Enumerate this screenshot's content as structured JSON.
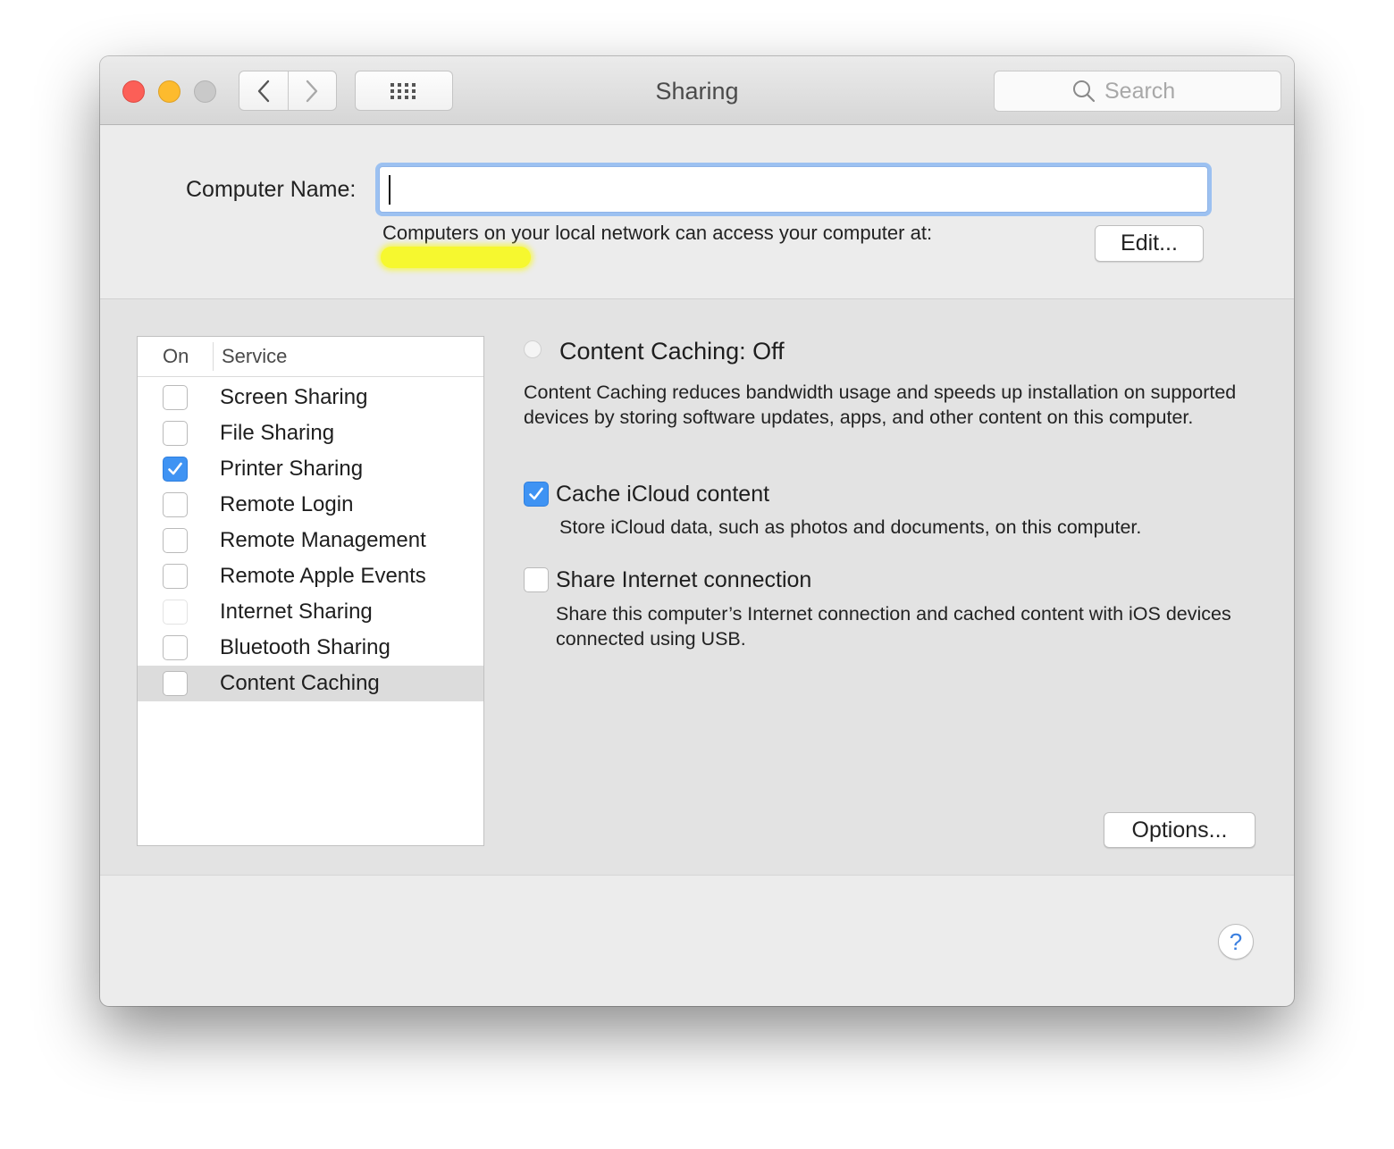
{
  "window": {
    "title": "Sharing"
  },
  "toolbar": {
    "search_placeholder": "Search"
  },
  "computer_name": {
    "label": "Computer Name:",
    "value": "",
    "access_text": "Computers on your local network can access your computer at:",
    "edit_label": "Edit..."
  },
  "services": {
    "header_on": "On",
    "header_service": "Service",
    "items": [
      {
        "label": "Screen Sharing",
        "checked": false,
        "enabled": true
      },
      {
        "label": "File Sharing",
        "checked": false,
        "enabled": true
      },
      {
        "label": "Printer Sharing",
        "checked": true,
        "enabled": true
      },
      {
        "label": "Remote Login",
        "checked": false,
        "enabled": true
      },
      {
        "label": "Remote Management",
        "checked": false,
        "enabled": true
      },
      {
        "label": "Remote Apple Events",
        "checked": false,
        "enabled": true
      },
      {
        "label": "Internet Sharing",
        "checked": false,
        "enabled": false
      },
      {
        "label": "Bluetooth Sharing",
        "checked": false,
        "enabled": true
      },
      {
        "label": "Content Caching",
        "checked": false,
        "enabled": true,
        "selected": true
      }
    ]
  },
  "detail": {
    "status": "Content Caching: Off",
    "description": "Content Caching reduces bandwidth usage and speeds up installation on supported devices by storing software updates, apps, and other content on this computer.",
    "cache_icloud": {
      "label": "Cache iCloud content",
      "checked": true,
      "description": "Store iCloud data, such as photos and documents, on this computer."
    },
    "share_internet": {
      "label": "Share Internet connection",
      "checked": false,
      "description": "Share this computer’s Internet connection and cached content with iOS devices connected using USB."
    },
    "options_label": "Options..."
  },
  "help": {
    "label": "?"
  },
  "colors": {
    "accent": "#3f93f3",
    "close": "#fc5f57",
    "minimize": "#fdbb2e",
    "zoom": "#c9c9c9",
    "highlight": "#f6f82f"
  }
}
